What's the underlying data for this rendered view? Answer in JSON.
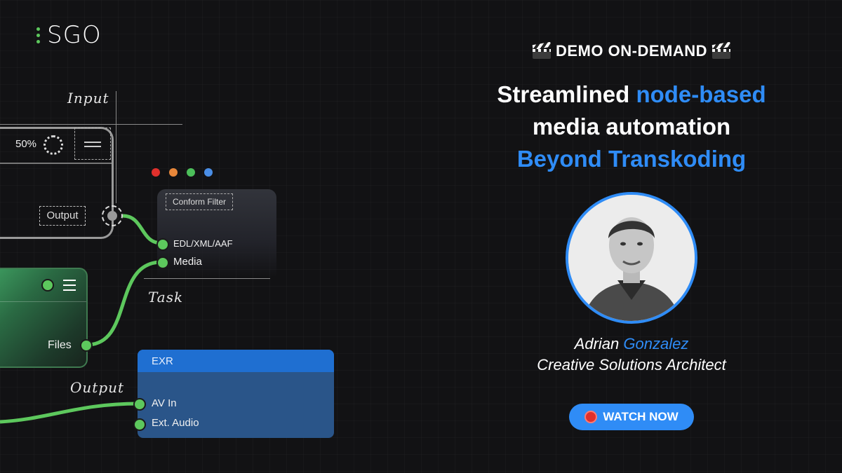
{
  "brand": {
    "logo_text": "SGO"
  },
  "diagram": {
    "annotations": {
      "input": "Input",
      "task": "Task",
      "output": "Output"
    },
    "input_node": {
      "zoom": "50%",
      "output_label": "Output"
    },
    "conform_node": {
      "title": "Conform Filter",
      "ports": [
        "EDL/XML/AAF",
        "Media"
      ]
    },
    "files_node": {
      "port": "Files"
    },
    "exr_node": {
      "title": "EXR",
      "ports": [
        "AV In",
        "Ext. Audio"
      ]
    },
    "window_dots": [
      "#e0302c",
      "#e8873a",
      "#4cbf5a",
      "#4a8ee6"
    ],
    "accent_green": "#5dc85d"
  },
  "promo": {
    "kicker": "DEMO ON-DEMAND",
    "kicker_icon": "clapperboard-icon",
    "headline_1": "Streamlined ",
    "headline_1_highlight": "node-based",
    "headline_2": "media automation",
    "headline_3": "Beyond Transkoding",
    "speaker_first": "Adrian",
    "speaker_last": "Gonzalez",
    "speaker_role": "Creative Solutions Architect",
    "cta_label": "WATCH NOW",
    "cta_icon": "red-record-icon",
    "accent_blue": "#2f8cf6"
  }
}
